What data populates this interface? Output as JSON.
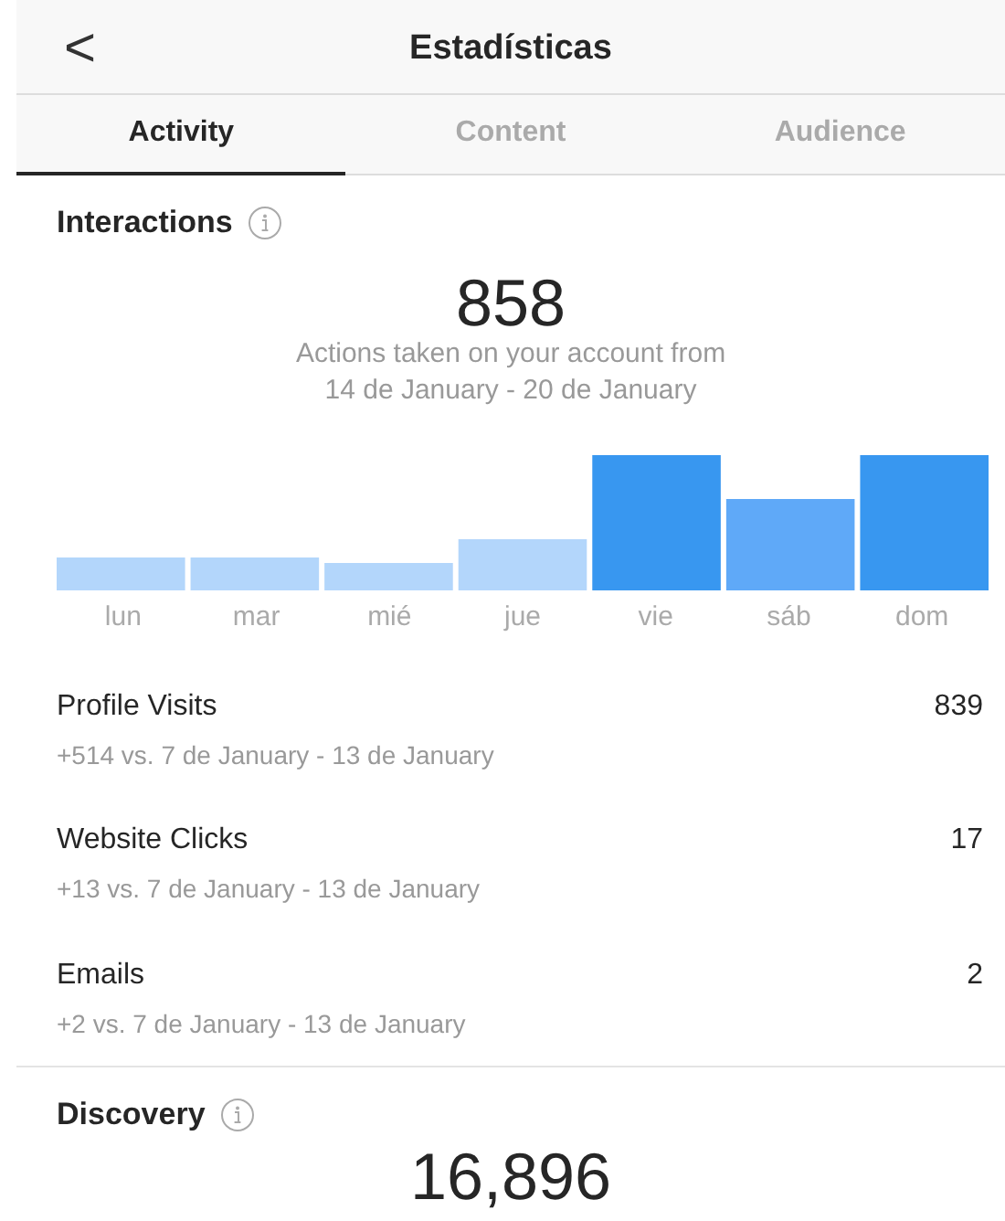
{
  "header": {
    "back": "<",
    "title": "Estadísticas"
  },
  "tabs": [
    {
      "label": "Activity",
      "selected": true
    },
    {
      "label": "Content",
      "selected": false
    },
    {
      "label": "Audience",
      "selected": false
    }
  ],
  "interactions": {
    "title": "Interactions",
    "total": "858",
    "caption_lines": [
      "Actions taken on your account from",
      "14 de January - 20 de January"
    ],
    "day_labels": [
      "lun",
      "mar",
      "mié",
      "jue",
      "vie",
      "sáb",
      "dom"
    ],
    "metrics": [
      {
        "label": "Profile Visits",
        "value": "839",
        "comparison": "+514 vs. 7 de January - 13 de January"
      },
      {
        "label": "Website Clicks",
        "value": "17",
        "comparison": "+13 vs. 7 de January - 13 de January"
      },
      {
        "label": "Emails",
        "value": "2",
        "comparison": "+2 vs. 7 de January - 13 de January"
      }
    ]
  },
  "discovery": {
    "title": "Discovery",
    "total": "16,896"
  }
}
